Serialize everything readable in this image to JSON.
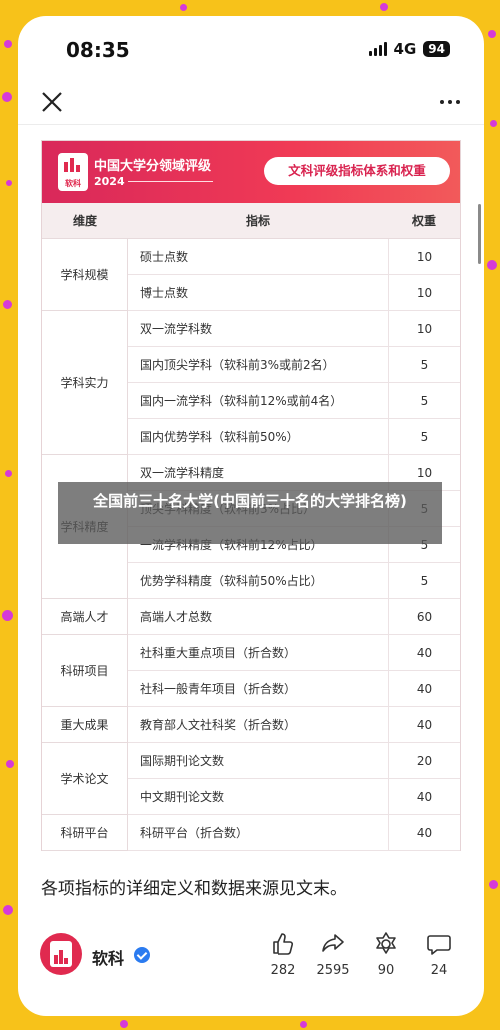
{
  "status_bar": {
    "time": "08:35",
    "network": "4G",
    "battery": "94"
  },
  "card": {
    "brand": "软科",
    "title": "中国大学分领域评级",
    "year": "2024",
    "pill": "文科评级指标体系和权重",
    "headers": {
      "dimension": "维度",
      "indicator": "指标",
      "weight": "权重"
    },
    "groups": [
      {
        "name": "学科规模",
        "rows": [
          {
            "indicator": "硕士点数",
            "weight": "10"
          },
          {
            "indicator": "博士点数",
            "weight": "10"
          }
        ]
      },
      {
        "name": "学科实力",
        "rows": [
          {
            "indicator": "双一流学科数",
            "weight": "10"
          },
          {
            "indicator": "国内顶尖学科（软科前3%或前2名）",
            "weight": "5"
          },
          {
            "indicator": "国内一流学科（软科前12%或前4名）",
            "weight": "5"
          },
          {
            "indicator": "国内优势学科（软科前50%）",
            "weight": "5"
          }
        ]
      },
      {
        "name": "学科精度",
        "rows": [
          {
            "indicator": "双一流学科精度",
            "weight": "10"
          },
          {
            "indicator": "顶尖学科精度（软科前3%占比）",
            "weight": "5"
          },
          {
            "indicator": "一流学科精度（软科前12%占比）",
            "weight": "5"
          },
          {
            "indicator": "优势学科精度（软科前50%占比）",
            "weight": "5"
          }
        ]
      },
      {
        "name": "高端人才",
        "rows": [
          {
            "indicator": "高端人才总数",
            "weight": "60"
          }
        ]
      },
      {
        "name": "科研项目",
        "rows": [
          {
            "indicator": "社科重大重点项目（折合数）",
            "weight": "40"
          },
          {
            "indicator": "社科一般青年项目（折合数）",
            "weight": "40"
          }
        ]
      },
      {
        "name": "重大成果",
        "rows": [
          {
            "indicator": "教育部人文社科奖（折合数）",
            "weight": "40"
          }
        ]
      },
      {
        "name": "学术论文",
        "rows": [
          {
            "indicator": "国际期刊论文数",
            "weight": "20"
          },
          {
            "indicator": "中文期刊论文数",
            "weight": "40"
          }
        ]
      },
      {
        "name": "科研平台",
        "rows": [
          {
            "indicator": "科研平台（折合数）",
            "weight": "40"
          }
        ]
      }
    ]
  },
  "overlay_title": "全国前三十名大学(中国前三十名的大学排名榜)",
  "caption": "各项指标的详细定义和数据来源见文末。",
  "author": {
    "name": "软科"
  },
  "actions": {
    "like": "282",
    "share": "2595",
    "favorite": "90",
    "comment": "24"
  },
  "colors": {
    "accent": "#e02a4f",
    "background": "#f7c21a",
    "dots": "#d63ad8"
  },
  "icons": [
    "close-icon",
    "more-icon",
    "like-icon",
    "share-icon",
    "favorite-icon",
    "comment-icon",
    "verified-icon"
  ]
}
